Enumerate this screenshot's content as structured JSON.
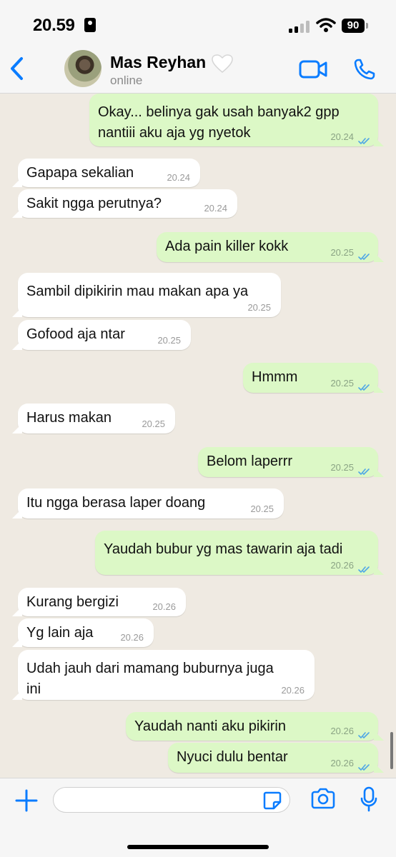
{
  "status_bar": {
    "time": "20.59",
    "battery": "90"
  },
  "header": {
    "contact_name": "Mas Reyhan",
    "contact_status": "online"
  },
  "messages": [
    {
      "dir": "out",
      "lines": [
        "Okay... belinya gak usah banyak2 gpp",
        "nantiii aku aja yg nyetok"
      ],
      "time": "20.24",
      "read": true
    },
    {
      "dir": "in",
      "lines": [
        "Gapapa sekalian"
      ],
      "time": "20.24"
    },
    {
      "dir": "in",
      "lines": [
        "Sakit ngga perutnya?"
      ],
      "time": "20.24"
    },
    {
      "dir": "out",
      "lines": [
        "Ada pain killer kokk"
      ],
      "time": "20.25",
      "read": true
    },
    {
      "dir": "in",
      "lines": [
        "Sambil dipikirin mau makan apa ya"
      ],
      "time": "20.25"
    },
    {
      "dir": "in",
      "lines": [
        "Gofood aja ntar"
      ],
      "time": "20.25"
    },
    {
      "dir": "out",
      "lines": [
        "Hmmm"
      ],
      "time": "20.25",
      "read": true
    },
    {
      "dir": "in",
      "lines": [
        "Harus makan"
      ],
      "time": "20.25"
    },
    {
      "dir": "out",
      "lines": [
        "Belom laperrr"
      ],
      "time": "20.25",
      "read": true
    },
    {
      "dir": "in",
      "lines": [
        "Itu ngga berasa laper doang"
      ],
      "time": "20.25"
    },
    {
      "dir": "out",
      "lines": [
        "Yaudah bubur yg mas tawarin aja tadi"
      ],
      "time": "20.26",
      "read": true
    },
    {
      "dir": "in",
      "lines": [
        "Kurang bergizi"
      ],
      "time": "20.26"
    },
    {
      "dir": "in",
      "lines": [
        "Yg lain aja"
      ],
      "time": "20.26"
    },
    {
      "dir": "in",
      "lines": [
        "Udah jauh dari mamang buburnya juga",
        "ini"
      ],
      "time": "20.26"
    },
    {
      "dir": "out",
      "lines": [
        "Yaudah nanti aku pikirin"
      ],
      "time": "20.26",
      "read": true
    },
    {
      "dir": "out",
      "lines": [
        "Nyuci dulu bentar"
      ],
      "time": "20.26",
      "read": true
    }
  ],
  "input": {
    "value": "",
    "placeholder": ""
  },
  "icons": {
    "back": "chevron-left-icon",
    "video": "video-camera-icon",
    "call": "phone-icon",
    "attach": "plus-icon",
    "sticker": "sticker-icon",
    "camera": "camera-icon",
    "mic": "microphone-icon",
    "heart": "white-heart-icon"
  },
  "colors": {
    "accent": "#0a7cff",
    "outgoing_bubble": "#dcf8c6",
    "incoming_bubble": "#ffffff",
    "chat_background": "#efeae2",
    "read_ticks": "#4fa7e6"
  }
}
